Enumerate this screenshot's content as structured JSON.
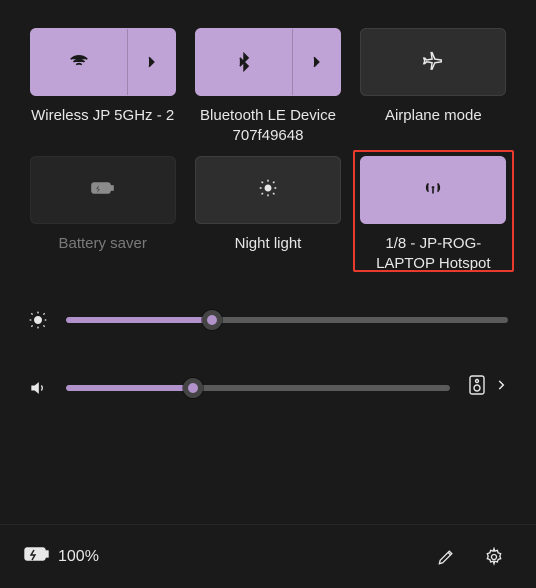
{
  "tiles": {
    "wifi": {
      "label": "Wireless JP 5GHz - 2",
      "active": true
    },
    "bluetooth": {
      "label": "Bluetooth LE Device 707f49648",
      "active": true
    },
    "airplane": {
      "label": "Airplane mode",
      "active": false
    },
    "battery_saver": {
      "label": "Battery saver",
      "disabled": true
    },
    "night_light": {
      "label": "Night light",
      "active": false
    },
    "hotspot": {
      "label": "1/8 - JP-ROG-LAPTOP Hotspot",
      "active": true,
      "highlighted": true
    }
  },
  "sliders": {
    "brightness": {
      "percent": 33
    },
    "volume": {
      "percent": 33
    }
  },
  "footer": {
    "battery_percent": "100%"
  },
  "colors": {
    "accent": "#c0a3d6",
    "highlight_border": "#e83a2d",
    "panel_bg": "#1a1a1a"
  }
}
